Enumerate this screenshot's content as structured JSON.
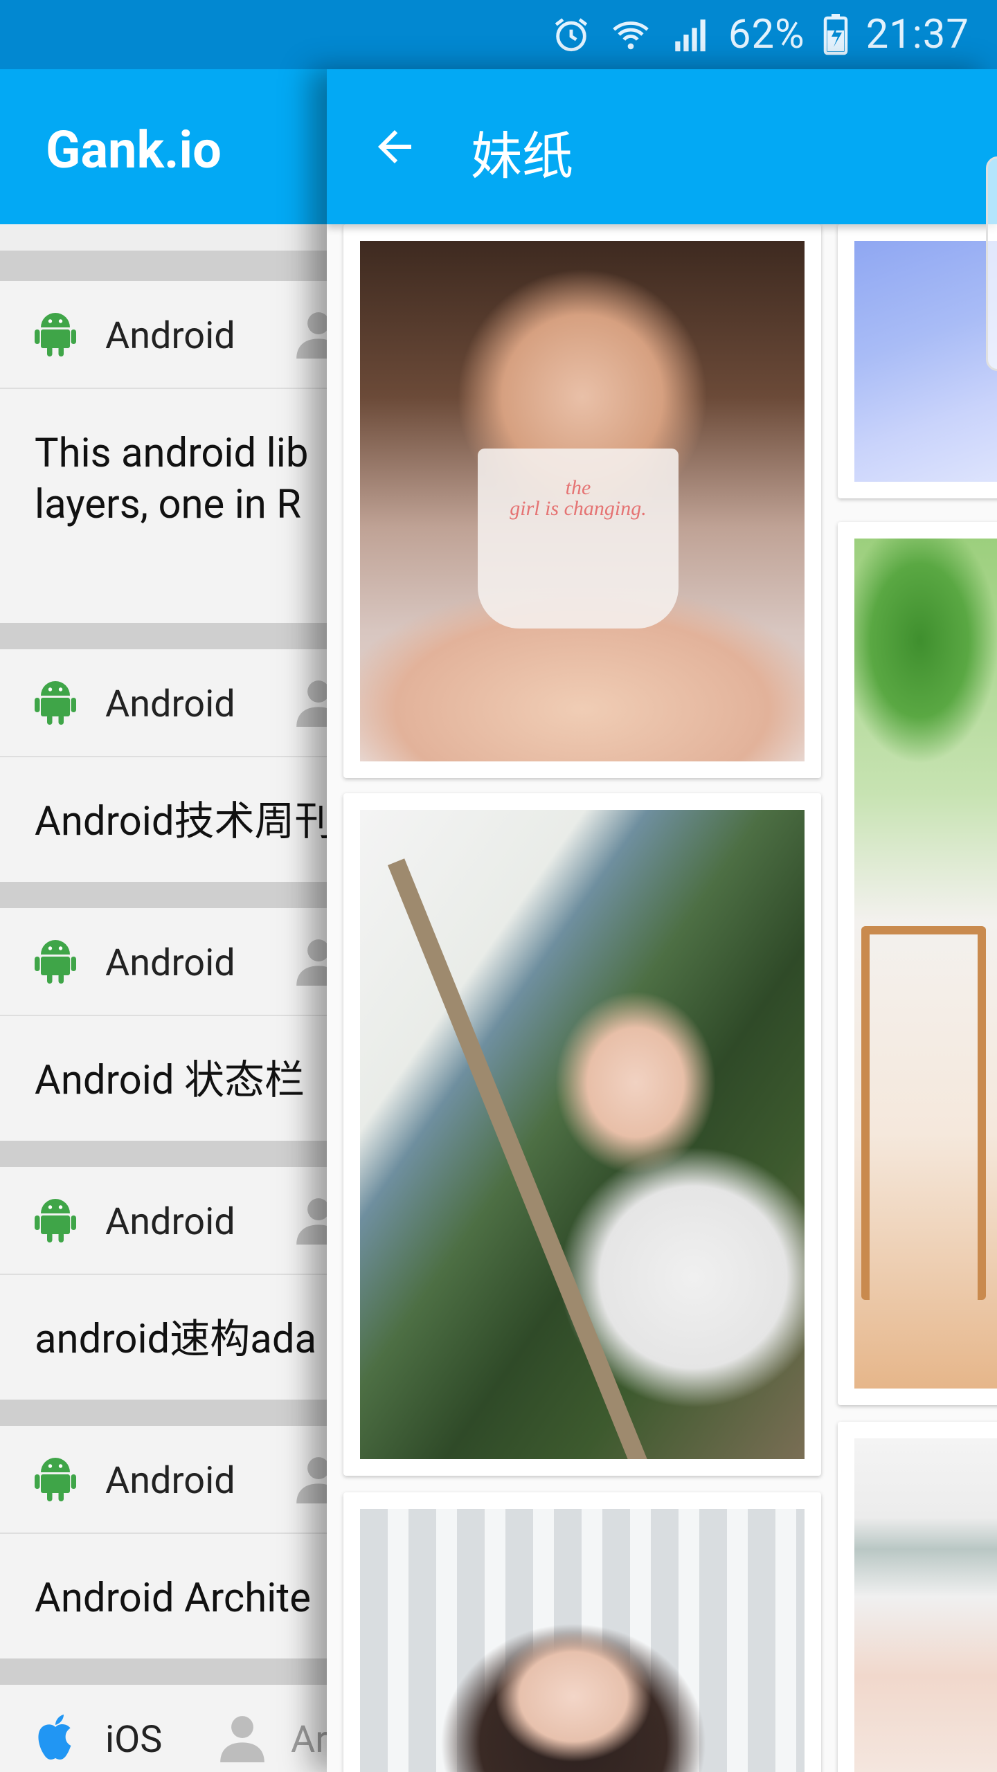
{
  "status_bar": {
    "battery": "62%",
    "time": "21:37"
  },
  "main_screen": {
    "app_title": "Gank.io",
    "feed": [
      {
        "category": "Android",
        "icon": "android-icon",
        "text_line1": "This android lib",
        "text_line2": "layers, one in R"
      },
      {
        "category": "Android",
        "icon": "android-icon",
        "text_line1": "Android技术周刊",
        "text_line2": ""
      },
      {
        "category": "Android",
        "icon": "android-icon",
        "text_line1": "Android 状态栏",
        "text_line2": ""
      },
      {
        "category": "Android",
        "icon": "android-icon",
        "text_line1": "android速构ada",
        "text_line2": ""
      },
      {
        "category": "Android",
        "icon": "android-icon",
        "text_line1": "Android Archite",
        "text_line2": ""
      },
      {
        "category": "iOS",
        "icon": "apple-icon",
        "author": "Ar",
        "text_line1": "",
        "text_line2": ""
      }
    ]
  },
  "drawer": {
    "title": "妹纸",
    "back_icon": "arrow-back-icon",
    "photo_text": {
      "line1": "the",
      "line2": "girl is changing."
    }
  },
  "colors": {
    "status_bar": "#0288d1",
    "app_bar": "#03a9f4",
    "android_green": "#3fa548",
    "ios_blue": "#2196f3"
  }
}
